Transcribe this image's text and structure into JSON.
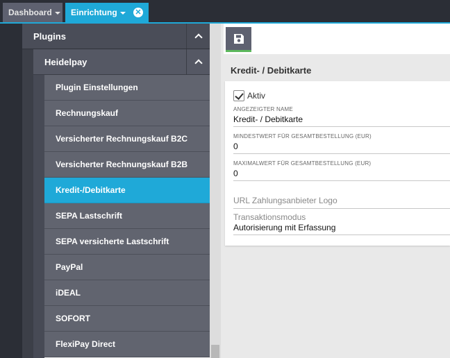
{
  "tabs": {
    "dashboard": "Dashboard",
    "einrichtung": "Einrichtung",
    "close_glyph": "✕"
  },
  "nav": {
    "plugins": "Plugins",
    "heidelpay": "Heidelpay",
    "items": [
      "Plugin Einstellungen",
      "Rechnungskauf",
      "Versicherter Rechnungskauf B2C",
      "Versicherter Rechnungskauf B2B",
      "Kredit-/Debitkarte",
      "SEPA Lastschrift",
      "SEPA versicherte Lastschrift",
      "PayPal",
      "iDEAL",
      "SOFORT",
      "FlexiPay Direct"
    ],
    "active_index": 4
  },
  "page": {
    "title": "Kredit- / Debitkarte",
    "active_label": "Aktiv",
    "active_checked": true,
    "fields": {
      "name_label": "Angezeigter Name",
      "name_value": "Kredit- / Debitkarte",
      "min_label": "Mindestwert für Gesamtbestellung (EUR)",
      "min_value": "0",
      "max_label": "Maximalwert für Gesamtbestellung (EUR)",
      "max_value": "0",
      "logo_placeholder": "URL Zahlungsanbieter Logo",
      "mode_label": "Transaktionsmodus",
      "mode_value": "Autorisierung mit Erfassung"
    }
  },
  "colors": {
    "accent": "#1fa9d8",
    "save_underline": "#5cb85c"
  }
}
